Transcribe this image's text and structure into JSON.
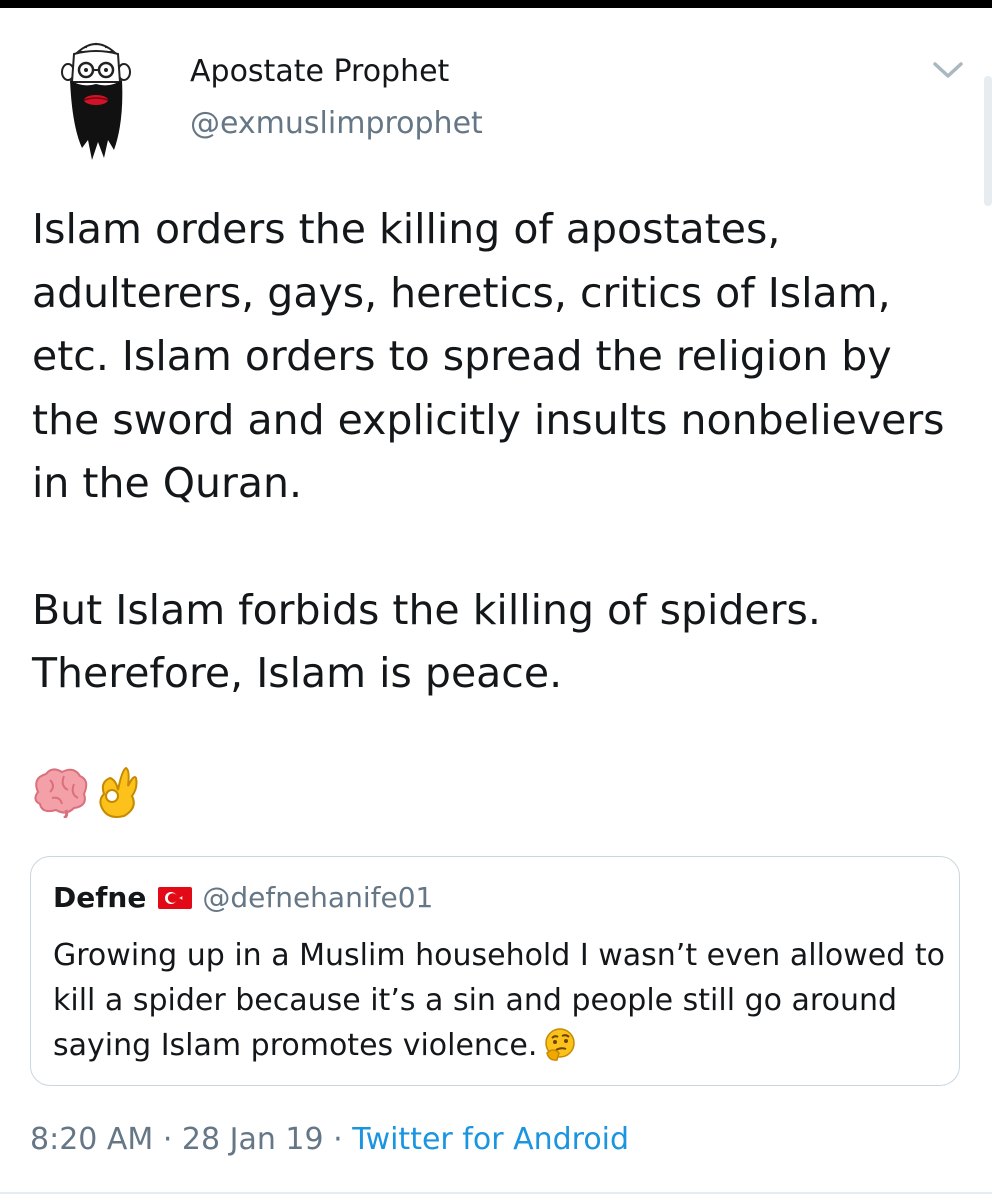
{
  "header": {
    "display_name": "Apostate Prophet",
    "handle": "@exmuslimprophet"
  },
  "tweet": {
    "paragraph1": "Islam orders the killing of apostates, adulterers, gays, heretics, critics of Islam, etc. Islam orders to spread the religion by the sword and explicitly insults nonbelievers in the Quran.",
    "paragraph2": "But Islam forbids the killing of spiders. Therefore, Islam is peace.",
    "emojis": [
      "brain-emoji",
      "ok-hand-emoji"
    ]
  },
  "quote": {
    "name": "Defne",
    "flag": "turkey-flag",
    "handle": "@defnehanife01",
    "text": "Growing up in a Muslim household I wasn’t even allowed to kill a spider because it’s a sin and people still go around saying Islam promotes violence.",
    "trailing_emoji": "thinking-face-emoji"
  },
  "meta": {
    "time": "8:20 AM",
    "sep1": " · ",
    "date": "28 Jan 19",
    "sep2": " · ",
    "source": "Twitter for Android"
  },
  "colors": {
    "text": "#14171a",
    "secondary": "#657786",
    "link": "#1b95e0",
    "border": "#ccd6dd"
  }
}
